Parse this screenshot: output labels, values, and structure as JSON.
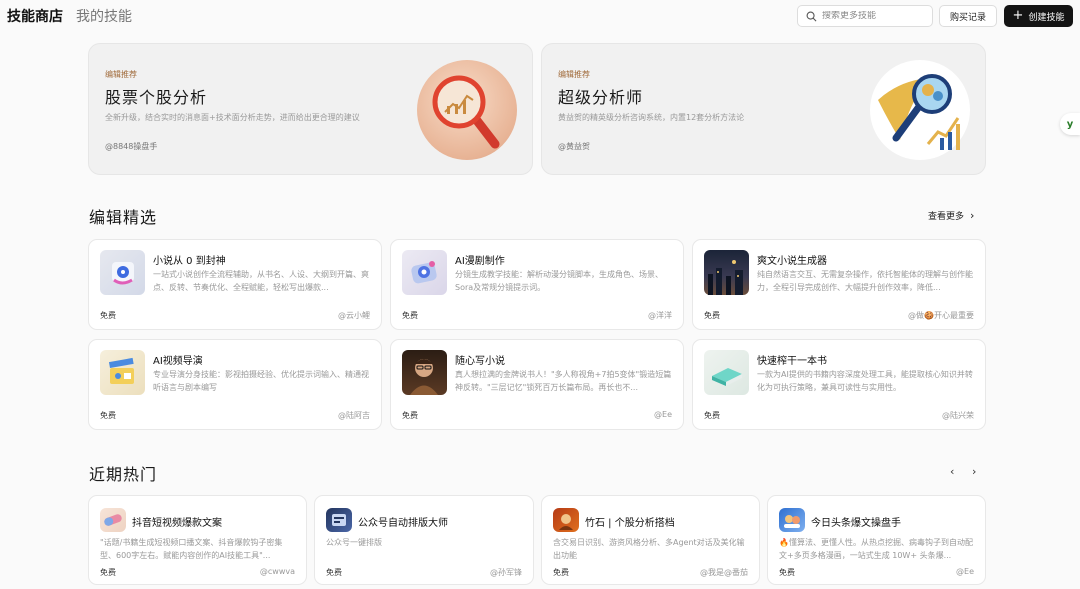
{
  "topbar": {
    "tab_active": "技能商店",
    "tab_inactive": "我的技能",
    "search_placeholder": "搜索更多技能",
    "history_label": "购买记录",
    "create_label": "创建技能",
    "side_badge": "y"
  },
  "banners": [
    {
      "tag": "编辑推荐",
      "title": "股票个股分析",
      "desc": "全新升级，结合实时的消息面+技术面分析走势，进而给出更合理的建议",
      "author": "@8848操盘手",
      "icon": "magnifier-chart-icon"
    },
    {
      "tag": "编辑推荐",
      "title": "超级分析师",
      "desc": "黄益贺的精英级分析咨询系统，内置12套分析方法论",
      "author": "@黄益贺",
      "icon": "brain-magnifier-icon"
    }
  ],
  "featured": {
    "title": "编辑精选",
    "see_more": "查看更多",
    "cards": [
      {
        "name": "小说从 0 到封神",
        "desc": "一站式小说创作全流程辅助，从书名、人设、大纲到开篇、爽点、反转、节奏优化、全程赋能，轻松写出爆款...",
        "price": "免费",
        "author": "@云小鲤",
        "icon": "novel-3d-icon"
      },
      {
        "name": "AI漫剧制作",
        "desc": "分镜生成教学技能：解析动漫分镜脚本，生成角色、场景、Sora及常规分镜提示词。",
        "price": "免费",
        "author": "@洋洋",
        "icon": "comic-3d-icon"
      },
      {
        "name": "爽文小说生成器",
        "desc": "纯自然语言交互、无需复杂操作，依托智能体的理解与创作能力，全程引导完成创作、大幅提升创作效率，降低...",
        "price": "免费",
        "author": "@做🍪开心最重要",
        "icon": "city-night-icon"
      },
      {
        "name": "AI视频导演",
        "desc": "专业导演分身技能：影视拍摄经验、优化提示词输入、精通视听语言与剧本编写",
        "price": "免费",
        "author": "@陆阿吉",
        "icon": "clapperboard-icon"
      },
      {
        "name": "随心写小说",
        "desc": "真人想拉满的金牌说书人！\"多人称视角+7拍5变体\"锻造短篇神反转。\"三层记忆\"锁死百万长篇布局。再长也不...",
        "price": "免费",
        "author": "@Ee",
        "icon": "storyteller-avatar-icon"
      },
      {
        "name": "快速榨干一本书",
        "desc": "一款为AI提供的书籍内容深度处理工具，能提取核心知识并转化为可执行策略，兼具可读性与实用性。",
        "price": "免费",
        "author": "@陆兴荣",
        "icon": "book-3d-icon"
      }
    ]
  },
  "trending": {
    "title": "近期热门",
    "prev": "‹",
    "next": "›",
    "cards": [
      {
        "name": "抖音短视频爆款文案",
        "desc": "\"话题/书籍生成短视频口播文案、抖音爆款钩子密集型、600字左右。赋能内容创作的AI技能工具\"...",
        "price": "免费",
        "author": "@cwwva",
        "icon": "capsule-icon"
      },
      {
        "name": "公众号自动排版大师",
        "desc": "公众号一键排版",
        "price": "免费",
        "author": "@孙军锋",
        "icon": "wechat-layout-icon"
      },
      {
        "name": "竹石 | 个股分析搭档",
        "desc": "含交易日识别、游资风格分析、多Agent对话及美化输出功能",
        "price": "免费",
        "author": "@我是@番茄",
        "icon": "bamboo-stone-icon"
      },
      {
        "name": "今日头条爆文操盘手",
        "desc": "🔥懂算法、更懂人性。从热点挖掘、病毒钩子到自动配文+多页多格漫画，一站式生成 10W+ 头条爆...",
        "price": "免费",
        "author": "@Ee",
        "icon": "toutiao-icon"
      }
    ]
  }
}
